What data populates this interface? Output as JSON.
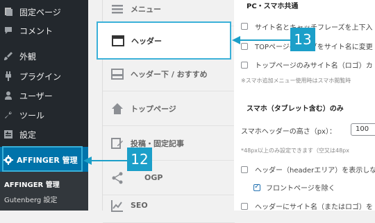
{
  "wp_sidebar": {
    "items": [
      {
        "label": "固定ページ",
        "icon": "pages-icon"
      },
      {
        "label": "コメント",
        "icon": "comments-icon"
      },
      {
        "label": "外観",
        "icon": "appearance-icon"
      },
      {
        "label": "プラグイン",
        "icon": "plugins-icon"
      },
      {
        "label": "ユーザー",
        "icon": "users-icon"
      },
      {
        "label": "ツール",
        "icon": "tools-icon"
      },
      {
        "label": "設定",
        "icon": "settings-icon"
      }
    ],
    "active": {
      "label": "AFFINGER 管理",
      "icon": "gear-icon"
    },
    "submenu": [
      {
        "label": "AFFINGER 管理"
      },
      {
        "label": "Gutenberg 設定"
      }
    ]
  },
  "tabs": [
    {
      "label": "メニュー",
      "icon": "menu-icon"
    },
    {
      "label": "ヘッダー",
      "icon": "header-icon"
    },
    {
      "label": "ヘッダー下 / おすすめ",
      "icon": "header-below-icon"
    },
    {
      "label": "トップページ",
      "icon": "home-icon"
    },
    {
      "label": "投稿・固定記事",
      "icon": "edit-icon"
    },
    {
      "label": "OGP",
      "icon": "share-icon"
    },
    {
      "label": "SEO",
      "icon": "chart-icon"
    }
  ],
  "panel": {
    "section_pc": "PC・スマホ共通",
    "opt_sitename": "サイト名とキャッチフレーズを上下入",
    "opt_top_sitename": "TOPページのみタグをサイト名に変更",
    "opt_top_only": "トップページのみサイト名（ロゴ）カ",
    "note_smartphone": "※スマホ追加メニュー使用時はスマホ閲覧時",
    "section_sp": "スマホ（タブレット含む）のみ",
    "header_height_label": "スマホヘッダーの高さ（px）：",
    "header_height_value": "100",
    "note_48px": "*48px以上のみ設定できます（空又は48px",
    "opt_header_hide": "ヘッダー（headerエリア）を表示しな",
    "opt_front_exclude": "フロントページを除く",
    "opt_header_sitename": "ヘッダーにサイト名（またはロゴ）を"
  },
  "callouts": {
    "c13": "13",
    "c12": "12"
  },
  "colors": {
    "accent": "#1c9fc9",
    "wp_sidebar": "#23282d",
    "wp_active": "#0073aa"
  }
}
